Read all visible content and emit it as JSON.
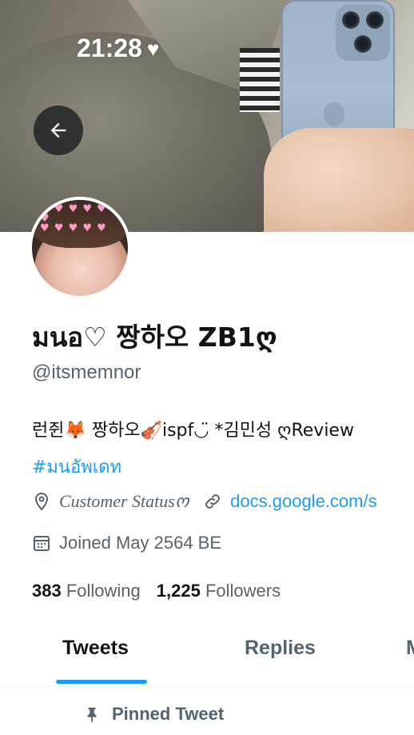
{
  "status_bar": {
    "time": "21:28",
    "heart": "♥"
  },
  "profile": {
    "display_name": "มนอ♡ 짱하오 ZB1ღ",
    "handle": "@itsmemnor",
    "bio": "런쥔🦊 짱하오🎻ispf◡̈ *김민성 ღReview",
    "hashtag": "#มนอัพเดท",
    "location": "Customer Statusო",
    "link": "docs.google.com/s",
    "joined": "Joined May 2564 BE",
    "following_count": "383",
    "following_label": "Following",
    "followers_count": "1,225",
    "followers_label": "Followers"
  },
  "tabs": [
    {
      "label": "Tweets",
      "active": true
    },
    {
      "label": "Replies",
      "active": false
    },
    {
      "label": "M",
      "active": false
    }
  ],
  "pinned_label": "Pinned Tweet",
  "colors": {
    "accent": "#1d9bf0",
    "text": "#0f1419",
    "secondary": "#536471"
  },
  "icons": [
    "back-arrow-icon",
    "location-pin-icon",
    "link-icon",
    "calendar-icon",
    "pin-icon",
    "heart-icon"
  ]
}
